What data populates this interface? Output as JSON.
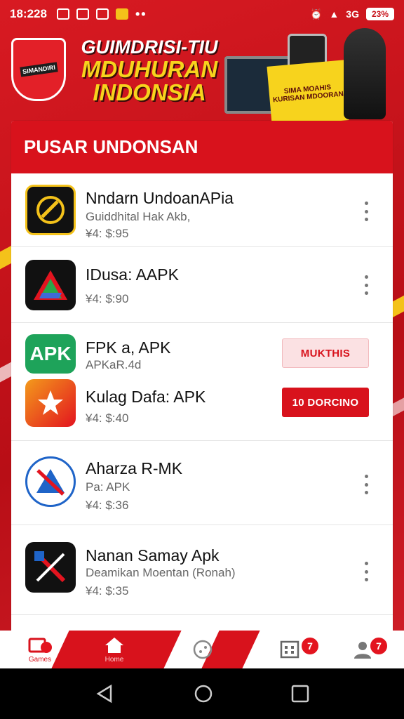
{
  "status_bar": {
    "time": "18:228",
    "dots": "••",
    "network": "3G",
    "battery": "23%"
  },
  "banner": {
    "logo_text": "SIMANDIRI",
    "title_line1": "GUIMDRISI-TIU",
    "title_line2": "MDUHURAN",
    "title_line3": "INDONSIA",
    "promo_text": "SIMA MOAHIS KURISAN MDOORAN"
  },
  "section": {
    "title": "PUSAR UNDONSAN"
  },
  "apps": [
    {
      "name": "Nndarn UndoanAPia",
      "subtitle": "Guiddhital Hak Akb,",
      "price": "¥4: $:95",
      "action": "menu"
    },
    {
      "name": "IDusa: AAPK",
      "subtitle": "",
      "price": "¥4: $:90",
      "action": "menu"
    },
    {
      "name": "FPK a, APK",
      "subtitle": "APKaR.4d",
      "price": "",
      "action": "MUKTHIS",
      "icon_text": "APK"
    },
    {
      "name": "Kulag Dafa: APK",
      "subtitle": "",
      "price": "¥4: $:40",
      "action": "10 DORCINO"
    },
    {
      "name": "Aharza R-MK",
      "subtitle": "Pa: APK",
      "price": "¥4: $:36",
      "action": "menu"
    },
    {
      "name": "Nanan Samay Apk",
      "subtitle": "Deamikan Moentan (Ronah)",
      "price": "¥4: $:35",
      "action": "menu"
    }
  ],
  "bottom_nav": {
    "items": [
      {
        "label": "Games",
        "icon": "game-icon"
      },
      {
        "label": "Home",
        "icon": "home-icon"
      },
      {
        "label": "",
        "icon": "explore-icon"
      },
      {
        "label": "",
        "icon": "apps-icon",
        "badge": "7"
      },
      {
        "label": "",
        "icon": "profile-icon",
        "badge": "7"
      }
    ]
  },
  "colors": {
    "primary_red": "#d8121c",
    "accent_yellow": "#f7d31d",
    "text_dark": "#111111",
    "text_grey": "#666666"
  }
}
